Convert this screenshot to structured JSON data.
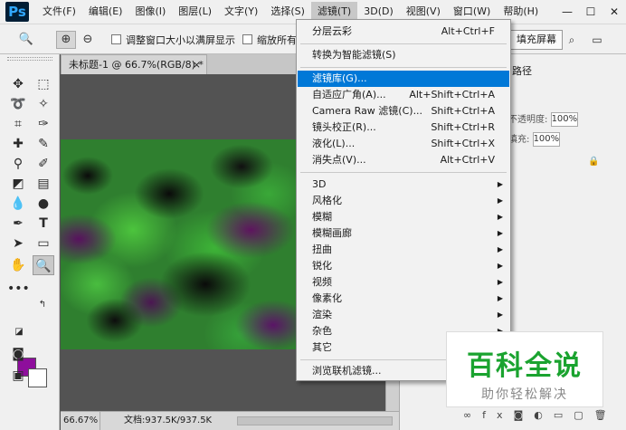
{
  "app": {
    "logo": "Ps"
  },
  "menubar": {
    "items": [
      "文件(F)",
      "编辑(E)",
      "图像(I)",
      "图层(L)",
      "文字(Y)",
      "选择(S)",
      "滤镜(T)",
      "3D(D)",
      "视图(V)",
      "窗口(W)",
      "帮助(H)"
    ],
    "active": "滤镜(T)"
  },
  "window_controls": {
    "minimize": "—",
    "maximize": "☐",
    "close": "✕"
  },
  "options_bar": {
    "resize_windows_label": "调整窗口大小以满屏显示",
    "zoom_all_label": "缩放所有",
    "fill_screen_label": "填充屏幕"
  },
  "document": {
    "tab_title": "未标题-1 @ 66.7%(RGB/8) *",
    "tab_close": "×",
    "zoom_value": "66.67%",
    "doc_info": "文档:937.5K/937.5K"
  },
  "right_panel": {
    "tab_label": "路径",
    "opacity_label": "不透明度:",
    "opacity_value": "100%",
    "fill_label": "填充:",
    "fill_value": "100%"
  },
  "filter_menu": {
    "items": [
      {
        "label": "分层云彩",
        "shortcut": "Alt+Ctrl+F"
      },
      {
        "label": "转换为智能滤镜(S)"
      },
      {
        "label": "滤镜库(G)...",
        "highlighted": true
      },
      {
        "label": "自适应广角(A)...",
        "shortcut": "Alt+Shift+Ctrl+A"
      },
      {
        "label": "Camera Raw 滤镜(C)...",
        "shortcut": "Shift+Ctrl+A"
      },
      {
        "label": "镜头校正(R)...",
        "shortcut": "Shift+Ctrl+R"
      },
      {
        "label": "液化(L)...",
        "shortcut": "Shift+Ctrl+X"
      },
      {
        "label": "消失点(V)...",
        "shortcut": "Alt+Ctrl+V"
      },
      {
        "label": "3D",
        "submenu": true
      },
      {
        "label": "风格化",
        "submenu": true
      },
      {
        "label": "模糊",
        "submenu": true
      },
      {
        "label": "模糊画廊",
        "submenu": true
      },
      {
        "label": "扭曲",
        "submenu": true
      },
      {
        "label": "锐化",
        "submenu": true
      },
      {
        "label": "视频",
        "submenu": true
      },
      {
        "label": "像素化",
        "submenu": true
      },
      {
        "label": "渲染",
        "submenu": true
      },
      {
        "label": "杂色",
        "submenu": true
      },
      {
        "label": "其它",
        "submenu": true
      },
      {
        "label": "浏览联机滤镜..."
      }
    ]
  },
  "colors": {
    "foreground": "#8e0e9c",
    "background": "#ffffff",
    "menu_highlight": "#0078d7"
  },
  "watermark": {
    "title": "百科全说",
    "subtitle": "助你轻松解决"
  }
}
